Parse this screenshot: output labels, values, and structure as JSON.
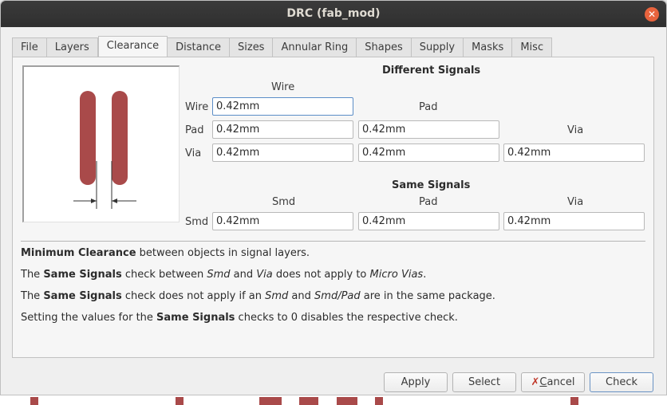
{
  "window": {
    "title": "DRC (fab_mod)"
  },
  "tabs": [
    "File",
    "Layers",
    "Clearance",
    "Distance",
    "Sizes",
    "Annular Ring",
    "Shapes",
    "Supply",
    "Masks",
    "Misc"
  ],
  "active_tab": "Clearance",
  "different_signals": {
    "header": "Different Signals",
    "col_wire": "Wire",
    "col_pad": "Pad",
    "col_via": "Via",
    "row_wire": "Wire",
    "row_pad": "Pad",
    "row_via": "Via",
    "wire_wire": "0.42mm",
    "pad_wire": "0.42mm",
    "pad_pad": "0.42mm",
    "via_wire": "0.42mm",
    "via_pad": "0.42mm",
    "via_via": "0.42mm"
  },
  "same_signals": {
    "header": "Same Signals",
    "col_smd": "Smd",
    "col_pad": "Pad",
    "col_via": "Via",
    "row_smd": "Smd",
    "smd_smd": "0.42mm",
    "smd_pad": "0.42mm",
    "smd_via": "0.42mm"
  },
  "info": {
    "l1_b": "Minimum Clearance",
    "l1_t": " between objects in signal layers.",
    "l2_a": "The ",
    "l2_b": "Same Signals",
    "l2_c": " check between ",
    "l2_d": "Smd",
    "l2_e": " and ",
    "l2_f": "Via",
    "l2_g": " does not apply to ",
    "l2_h": "Micro Vias",
    "l2_i": ".",
    "l3_a": "The ",
    "l3_b": "Same Signals",
    "l3_c": " check does not apply if an ",
    "l3_d": "Smd",
    "l3_e": " and ",
    "l3_f": "Smd/Pad",
    "l3_g": " are in the same package.",
    "l4_a": "Setting the values for the ",
    "l4_b": "Same Signals",
    "l4_c": " checks to 0 disables the respective check."
  },
  "buttons": {
    "apply": "Apply",
    "select": "Select",
    "cancel_mnemonic": "C",
    "cancel_rest": "ancel",
    "check": "Check"
  },
  "colors": {
    "trace": "#a94a4a",
    "close": "#e8633d",
    "titlebar": "#333333"
  }
}
